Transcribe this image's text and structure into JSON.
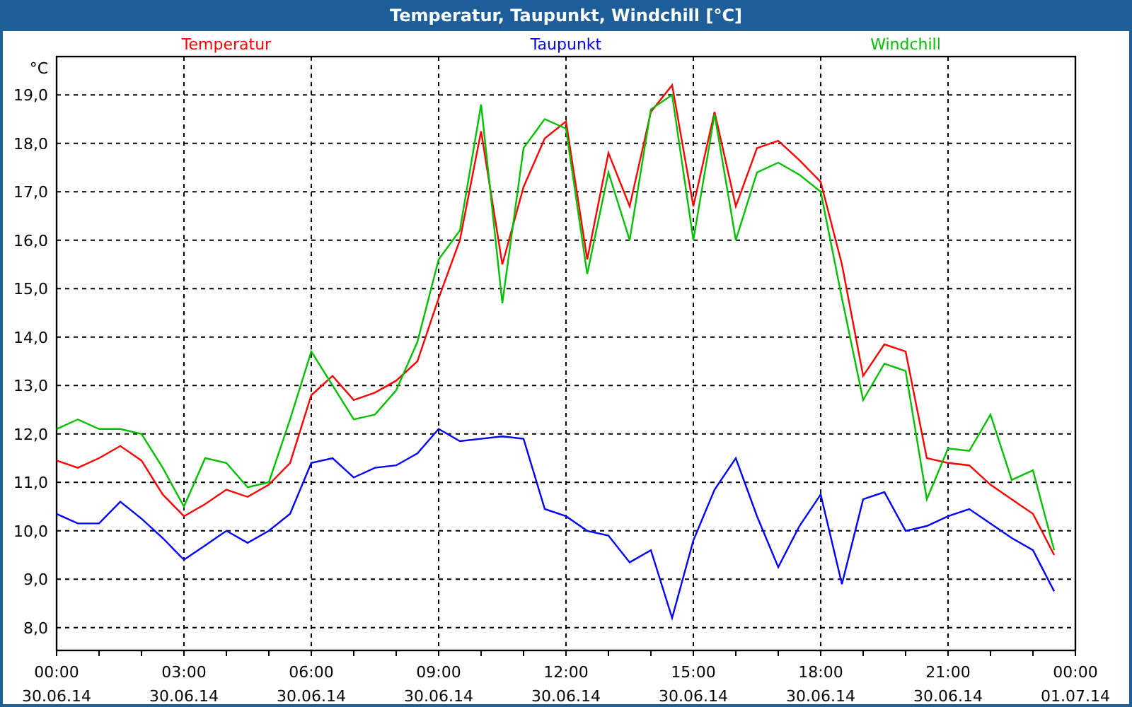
{
  "window": {
    "title": "Temperatur, Taupunkt, Windchill [°C]"
  },
  "chart_data": {
    "type": "line",
    "grid": true,
    "ylabel": "°C",
    "ylim": [
      7.53,
      19.79
    ],
    "categories": [
      "00:00\n30.06.14",
      null,
      null,
      null,
      null,
      null,
      "03:00\n30.06.14",
      null,
      null,
      null,
      null,
      null,
      "06:00\n30.06.14",
      null,
      null,
      null,
      null,
      null,
      "09:00\n30.06.14",
      null,
      null,
      null,
      null,
      null,
      "12:00\n30.06.14",
      null,
      null,
      null,
      null,
      null,
      "15:00\n30.06.14",
      null,
      null,
      null,
      null,
      null,
      "18:00\n30.06.14",
      null,
      null,
      null,
      null,
      null,
      "21:00\n30.06.14",
      null,
      null,
      null,
      null,
      null,
      "00:00\n01.07.14"
    ],
    "series": [
      {
        "name": "Temperatur",
        "color": "#ff0000",
        "values": [
          11.45,
          11.3,
          11.5,
          11.75,
          11.45,
          10.75,
          10.3,
          10.55,
          10.85,
          10.7,
          10.95,
          11.4,
          12.8,
          13.2,
          12.7,
          12.85,
          13.1,
          13.5,
          14.8,
          16.0,
          18.25,
          15.5,
          17.1,
          18.1,
          18.45,
          15.6,
          17.8,
          16.7,
          18.65,
          19.2,
          16.7,
          18.65,
          16.7,
          17.9,
          18.05,
          17.65,
          17.2,
          15.5,
          13.2,
          13.85,
          13.7,
          11.5,
          11.4,
          11.35,
          10.95,
          10.65,
          10.35,
          9.5,
          null
        ]
      },
      {
        "name": "Taupunkt",
        "color": "#0000ff",
        "values": [
          10.35,
          10.15,
          10.15,
          10.6,
          10.25,
          9.85,
          9.4,
          9.7,
          10.0,
          9.75,
          10.0,
          10.35,
          11.4,
          11.5,
          11.1,
          11.3,
          11.35,
          11.6,
          12.1,
          11.85,
          11.9,
          11.95,
          11.9,
          10.45,
          10.3,
          10.0,
          9.9,
          9.35,
          9.6,
          8.2,
          9.8,
          10.85,
          11.5,
          10.3,
          9.25,
          10.1,
          10.75,
          8.9,
          10.65,
          10.8,
          10.0,
          10.1,
          10.3,
          10.45,
          10.15,
          9.85,
          9.6,
          8.75,
          null
        ]
      },
      {
        "name": "Windchill",
        "color": "#00c000",
        "values": [
          12.1,
          12.3,
          12.1,
          12.1,
          12.0,
          11.3,
          10.5,
          11.5,
          11.4,
          10.9,
          11.0,
          12.3,
          13.7,
          13.0,
          12.3,
          12.4,
          12.9,
          13.9,
          15.6,
          16.2,
          18.8,
          14.7,
          17.9,
          18.5,
          18.3,
          15.3,
          17.4,
          16.0,
          18.7,
          19.0,
          16.0,
          18.6,
          16.0,
          17.4,
          17.6,
          17.35,
          17.0,
          14.8,
          12.7,
          13.45,
          13.3,
          10.65,
          11.7,
          11.65,
          12.4,
          11.05,
          11.25,
          9.6,
          null
        ]
      }
    ],
    "yticks": [
      {
        "value": 8,
        "label": "8,0"
      },
      {
        "value": 9,
        "label": "9,0"
      },
      {
        "value": 10,
        "label": "10,0"
      },
      {
        "value": 11,
        "label": "11,0"
      },
      {
        "value": 12,
        "label": "12,0"
      },
      {
        "value": 13,
        "label": "13,0"
      },
      {
        "value": 14,
        "label": "14,0"
      },
      {
        "value": 15,
        "label": "15,0"
      },
      {
        "value": 16,
        "label": "16,0"
      },
      {
        "value": 17,
        "label": "17,0"
      },
      {
        "value": 18,
        "label": "18,0"
      },
      {
        "value": 19,
        "label": "19,0"
      }
    ]
  }
}
